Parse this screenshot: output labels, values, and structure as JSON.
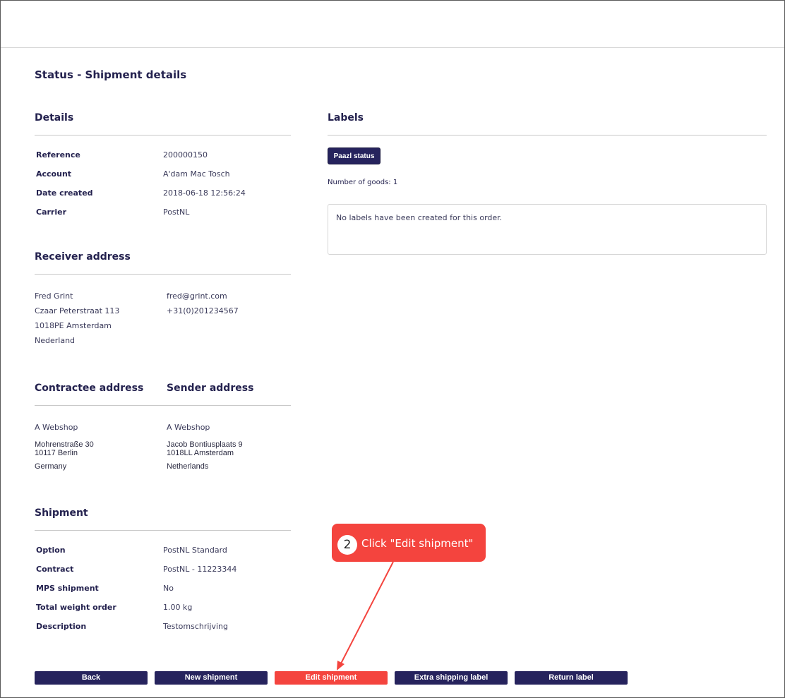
{
  "page": {
    "title": "Status - Shipment details"
  },
  "details": {
    "heading": "Details",
    "rows": [
      {
        "key": "Reference",
        "value": "200000150"
      },
      {
        "key": "Account",
        "value": "A'dam Mac Tosch"
      },
      {
        "key": "Date created",
        "value": "2018-06-18 12:56:24"
      },
      {
        "key": "Carrier",
        "value": "PostNL"
      }
    ]
  },
  "receiver": {
    "heading": "Receiver address",
    "name": "Fred Grint",
    "street": "Czaar Peterstraat 113",
    "city": "1018PE Amsterdam",
    "country": "Nederland",
    "email": "fred@grint.com",
    "phone": "+31(0)201234567"
  },
  "contractee": {
    "heading": "Contractee address",
    "company": "A Webshop",
    "street": "Mohrenstraße 30",
    "city": "10117 Berlin",
    "country": "Germany"
  },
  "sender": {
    "heading": "Sender address",
    "company": "A Webshop",
    "street": "Jacob Bontiusplaats 9",
    "city": "1018LL Amsterdam",
    "country": "Netherlands"
  },
  "shipment": {
    "heading": "Shipment",
    "rows": [
      {
        "key": "Option",
        "value": "PostNL Standard"
      },
      {
        "key": "Contract",
        "value": "PostNL - 11223344"
      },
      {
        "key": "MPS shipment",
        "value": "No"
      },
      {
        "key": "Total weight order",
        "value": "1.00 kg"
      },
      {
        "key": "Description",
        "value": "Testomschrijving"
      }
    ]
  },
  "labels": {
    "heading": "Labels",
    "status_button": "Paazl status",
    "goods_label": "Number of goods:",
    "goods_count": "1",
    "empty_message": "No labels have been created for this order."
  },
  "actions": {
    "back": "Back",
    "new_shipment": "New shipment",
    "edit_shipment": "Edit shipment",
    "extra_label": "Extra shipping label",
    "return_label": "Return label"
  },
  "callout": {
    "step": "2",
    "text": "Click \"Edit shipment\""
  },
  "colors": {
    "primary": "#26235d",
    "highlight": "#f4443e",
    "text": "#24224f"
  }
}
